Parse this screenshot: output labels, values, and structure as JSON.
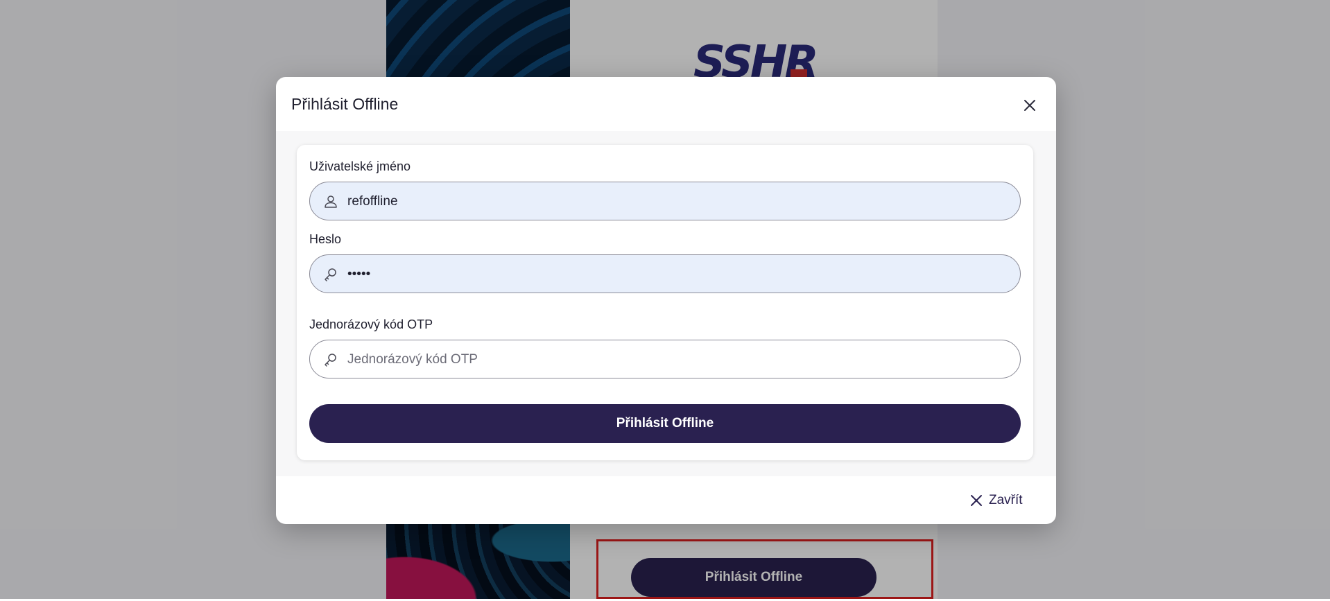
{
  "background": {
    "logo_text": "SSHR",
    "submit_label": "Přihlásit Offline"
  },
  "modal": {
    "title": "Přihlásit Offline",
    "username": {
      "label": "Uživatelské jméno",
      "value": "refoffline",
      "icon": "user-icon"
    },
    "password": {
      "label": "Heslo",
      "value": "•••••",
      "icon": "key-icon"
    },
    "otp": {
      "label": "Jednorázový kód OTP",
      "placeholder": "Jednorázový kód OTP",
      "value": "",
      "icon": "key-icon"
    },
    "submit_label": "Přihlásit Offline",
    "close_label": "Zavřít"
  },
  "colors": {
    "primary": "#2a2150",
    "filled_input_bg": "#e8effb",
    "highlight": "#e02020"
  }
}
